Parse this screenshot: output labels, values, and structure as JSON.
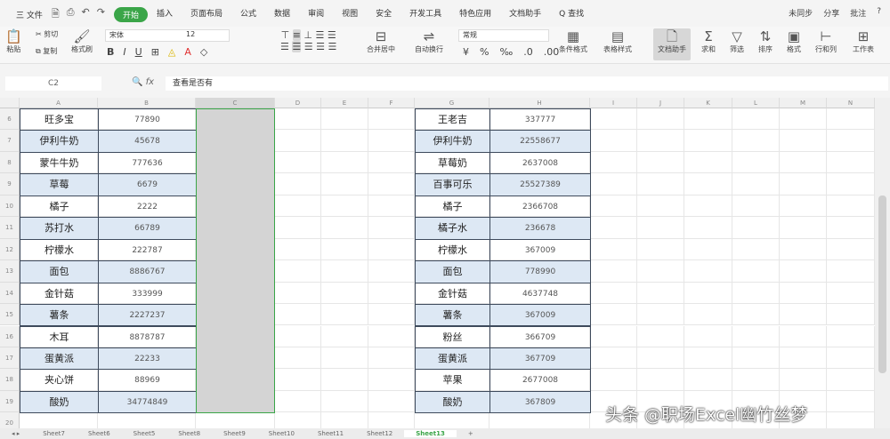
{
  "menu": {
    "file": "三 文件",
    "items": [
      "开始",
      "插入",
      "页面布局",
      "公式",
      "数据",
      "审阅",
      "视图",
      "安全",
      "开发工具",
      "特色应用",
      "文档助手",
      "Q 查找"
    ],
    "active_index": 0,
    "right": [
      "未同步",
      "分享",
      "批注",
      "?"
    ]
  },
  "ribbon": {
    "paste": "粘贴",
    "cut": "剪切",
    "copy": "复制",
    "format_painter": "格式刷",
    "font": "宋体",
    "size": "12",
    "merge": "合并居中",
    "wrap": "自动换行",
    "numformat": "常规",
    "cond_format": "条件格式",
    "table_style": "表格样式",
    "doc_helper": "文档助手",
    "sum": "求和",
    "filter": "筛选",
    "sort": "排序",
    "format": "格式",
    "rowcol": "行和列",
    "sheet": "工作表"
  },
  "formula": {
    "name_box": "C2",
    "fx": "fx",
    "value": "查看是否有"
  },
  "columns": [
    "A",
    "B",
    "C",
    "D",
    "E",
    "F",
    "G",
    "H",
    "I",
    "J",
    "K",
    "L",
    "M",
    "N"
  ],
  "rows": [
    "6",
    "7",
    "8",
    "9",
    "10",
    "11",
    "12",
    "13",
    "14",
    "15",
    "16",
    "17",
    "18",
    "19",
    "20"
  ],
  "left_table": [
    [
      "旺多宝",
      "77890"
    ],
    [
      "伊利牛奶",
      "45678"
    ],
    [
      "蒙牛牛奶",
      "777636"
    ],
    [
      "草莓",
      "6679"
    ],
    [
      "橘子",
      "2222"
    ],
    [
      "苏打水",
      "66789"
    ],
    [
      "柠檬水",
      "222787"
    ],
    [
      "面包",
      "8886767"
    ],
    [
      "金针菇",
      "333999"
    ],
    [
      "薯条",
      "2227237"
    ],
    [
      "木耳",
      "8878787"
    ],
    [
      "蛋黄派",
      "22233"
    ],
    [
      "夹心饼",
      "88969"
    ],
    [
      "酸奶",
      "34774849"
    ]
  ],
  "right_table": [
    [
      "王老吉",
      "337777"
    ],
    [
      "伊利牛奶",
      "22558677"
    ],
    [
      "草莓奶",
      "2637008"
    ],
    [
      "百事可乐",
      "25527389"
    ],
    [
      "橘子",
      "2366708"
    ],
    [
      "橘子水",
      "236678"
    ],
    [
      "柠檬水",
      "367009"
    ],
    [
      "面包",
      "778990"
    ],
    [
      "金针菇",
      "4637748"
    ],
    [
      "薯条",
      "367009"
    ],
    [
      "粉丝",
      "366709"
    ],
    [
      "蛋黄派",
      "367709"
    ],
    [
      "苹果",
      "2677008"
    ],
    [
      "酸奶",
      "367809"
    ]
  ],
  "sheet_tabs": [
    "Sheet7",
    "Sheet6",
    "Sheet5",
    "Sheet8",
    "Sheet9",
    "Sheet10",
    "Sheet11",
    "Sheet12",
    "Sheet13"
  ],
  "active_sheet_index": 8,
  "watermark": "头条 @职场Excel幽竹丝梦"
}
